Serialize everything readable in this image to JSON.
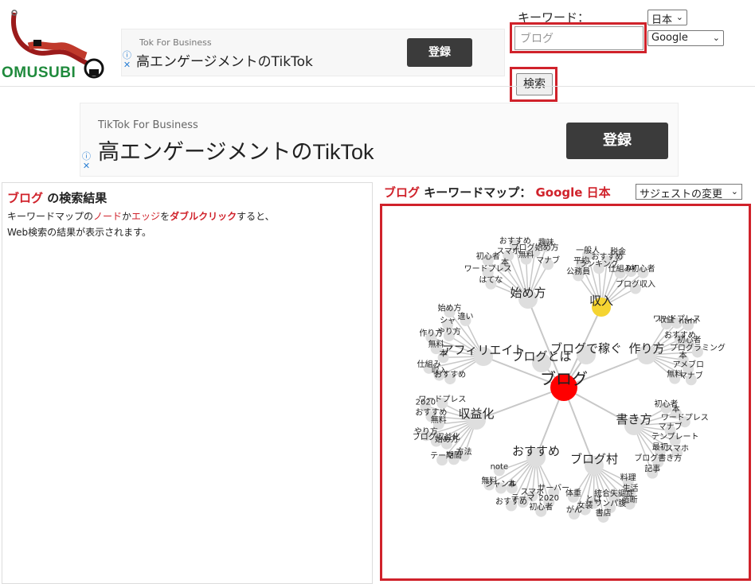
{
  "header": {
    "logo_text": "OMUSUBI",
    "ad_small": {
      "brand": "Tok For Business",
      "headline": "高エンゲージメントのTikTok",
      "register": "登録"
    },
    "keyword_label": "キーワード：",
    "country_select": "日本",
    "engine_select": "Google",
    "keyword_value": "ブログ",
    "search_button": "検索"
  },
  "ad_big": {
    "brand": "TikTok For Business",
    "headline": "高エンゲージメントのTikTok",
    "register": "登録"
  },
  "results": {
    "keyword": "ブログ",
    "title_suffix": " の検索結果",
    "desc_1": "キーワードマップの",
    "desc_node": "ノード",
    "desc_ka": "か",
    "desc_edge": "エッジ",
    "desc_wo": "を",
    "desc_dbl": "ダブルクリック",
    "desc_2": "すると、",
    "desc_3": "Web検索の結果が表示されます。"
  },
  "map_header": {
    "keyword": "ブログ",
    "label": " キーワードマップ：",
    "engine_country": "Google 日本",
    "suggest_select": "サジェストの変更"
  },
  "colors": {
    "accent_red": "#d0222b",
    "root_node": "#ff0000",
    "highlight_node": "#f5d431",
    "node": "#dedede",
    "edge": "#c8c8c8"
  },
  "icons": [
    "info-icon",
    "close-icon",
    "dropdown-arrow-icon"
  ],
  "keyword_map": {
    "root": {
      "label": "ブログ"
    },
    "hubs": [
      {
        "label": "始め方",
        "leaves": [
          "はてな",
          "ワードプレス",
          "初心者",
          "本",
          "スマホ",
          "おすすめ",
          "無料",
          "ブログ始め方",
          "趣味",
          "マナブ"
        ]
      },
      {
        "label": "収入",
        "leaves": [
          "公務員",
          "平均",
          "一般人",
          "ランキング",
          "おすすめ",
          "税金",
          "仕組み",
          "pv",
          "初心者",
          "ブログ収入"
        ]
      },
      {
        "label": "作り方",
        "leaves": [
          "収益",
          "ワードプレス",
          "html",
          "おすすめ",
          "初心者",
          "プログラミング",
          "本",
          "アメブロ",
          "マナブ",
          "無料"
        ]
      },
      {
        "label": "書き方",
        "leaves": [
          "初心者",
          "本",
          "ワードプレス",
          "マナブ",
          "テンプレート",
          "スマホ",
          "最初",
          "ブログ書き方",
          "記事"
        ]
      },
      {
        "label": "ブログ村",
        "leaves": [
          "料理",
          "生活",
          "造断",
          "統合失調症",
          "リンパ腹",
          "書店",
          "とは",
          "女装",
          "がん",
          "体重"
        ]
      },
      {
        "label": "おすすめ",
        "leaves": [
          "サーバー",
          "2020",
          "初心者",
          "スマホ",
          "テーマ",
          "おすすめ",
          "本",
          "ジャンル",
          "無料",
          "note"
        ]
      },
      {
        "label": "収益化",
        "leaves": [
          "方法",
          "期間",
          "テーマ",
          "始め方",
          "ブログ収益化",
          "やり方",
          "無料",
          "おすすめ",
          "2020",
          "ワードプレス"
        ]
      },
      {
        "label": "アフィリエイト",
        "leaves": [
          "おすすめ",
          "収入",
          "仕組み",
          "本",
          "無料",
          "作り方",
          "やり方",
          "シャ",
          "始め方",
          "違い"
        ]
      },
      {
        "label": "ブログとは",
        "leaves": []
      },
      {
        "label": "ブログで稼ぐ",
        "leaves": []
      }
    ]
  }
}
